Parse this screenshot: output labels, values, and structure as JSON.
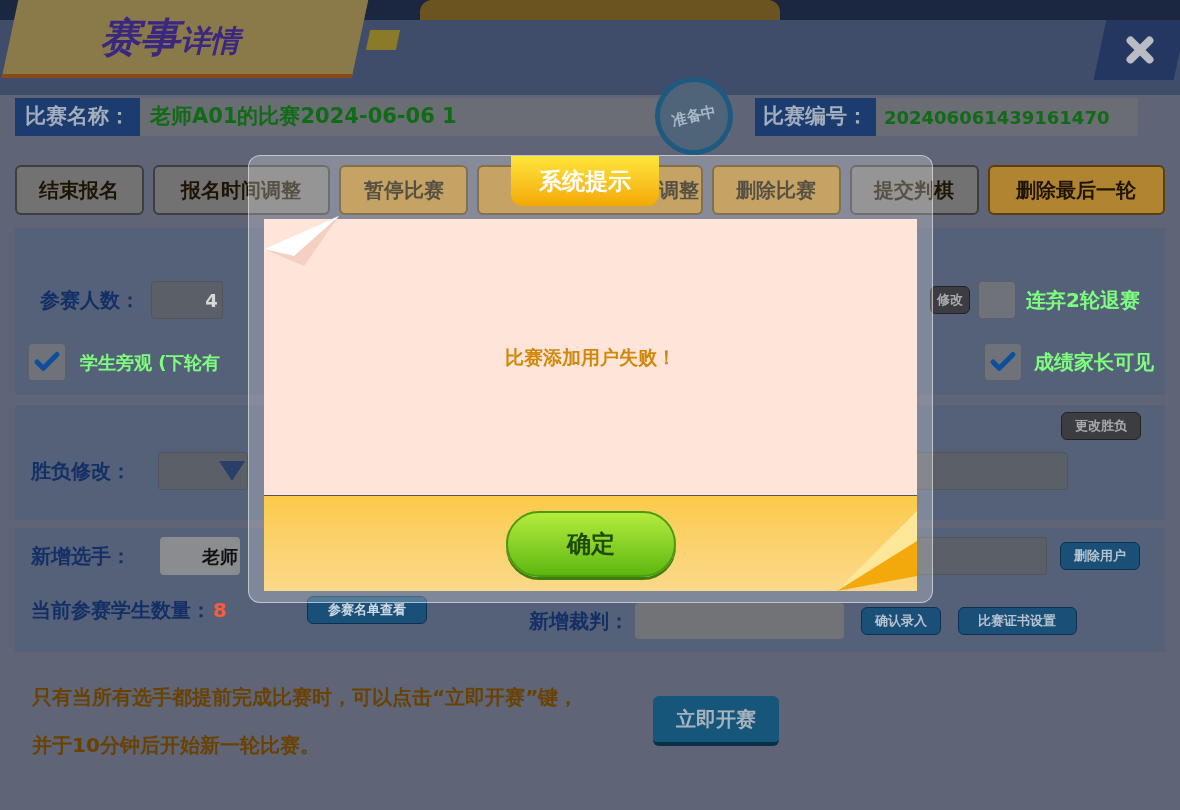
{
  "header": {
    "title_main": "赛事",
    "title_sub": "详情"
  },
  "info": {
    "name_label": "比赛名称：",
    "name_value": "老师A01的比赛2024-06-06 1",
    "status_stamp": "准备中",
    "id_label": "比赛编号：",
    "id_value": "202406061439161470"
  },
  "actions": [
    {
      "label": "结束报名",
      "kind": "gray"
    },
    {
      "label": "报名时间调整",
      "kind": "gray"
    },
    {
      "label": "暂停比赛",
      "kind": "orange"
    },
    {
      "label": "调整",
      "kind": "orange"
    },
    {
      "label": "删除比赛",
      "kind": "orange"
    },
    {
      "label": "提交判棋",
      "kind": "gray"
    },
    {
      "label": "删除最后一轮",
      "kind": "orange"
    }
  ],
  "settings": {
    "participants_label": "参赛人数：",
    "participants_value": "4",
    "modify_button": "修改",
    "forfeit": {
      "label": "连弃2轮退赛",
      "checked": false
    },
    "spectate": {
      "label": "学生旁观 (下轮有",
      "checked": true
    },
    "parents": {
      "label": "成绩家长可见",
      "checked": true
    }
  },
  "result_edit": {
    "label": "胜负修改：",
    "button": "更改胜负"
  },
  "players": {
    "add_label": "新增选手：",
    "add_value": "老师",
    "delete_button": "删除用户",
    "count_label": "当前参赛学生数量：",
    "count_value": "8",
    "list_button": "参赛名单查看",
    "referee_label": "新增裁判：",
    "confirm_button": "确认录入",
    "certificate_button": "比赛证书设置"
  },
  "notice": {
    "lines": [
      "只有当所有选手都提前完成比赛时，可以点击“立即开赛”键，",
      "并于10分钟后开始新一轮比赛。"
    ],
    "start_button": "立即开赛"
  },
  "dialog": {
    "title": "系统提示",
    "message": "比赛添加用户失败！",
    "ok_button": "确定"
  }
}
